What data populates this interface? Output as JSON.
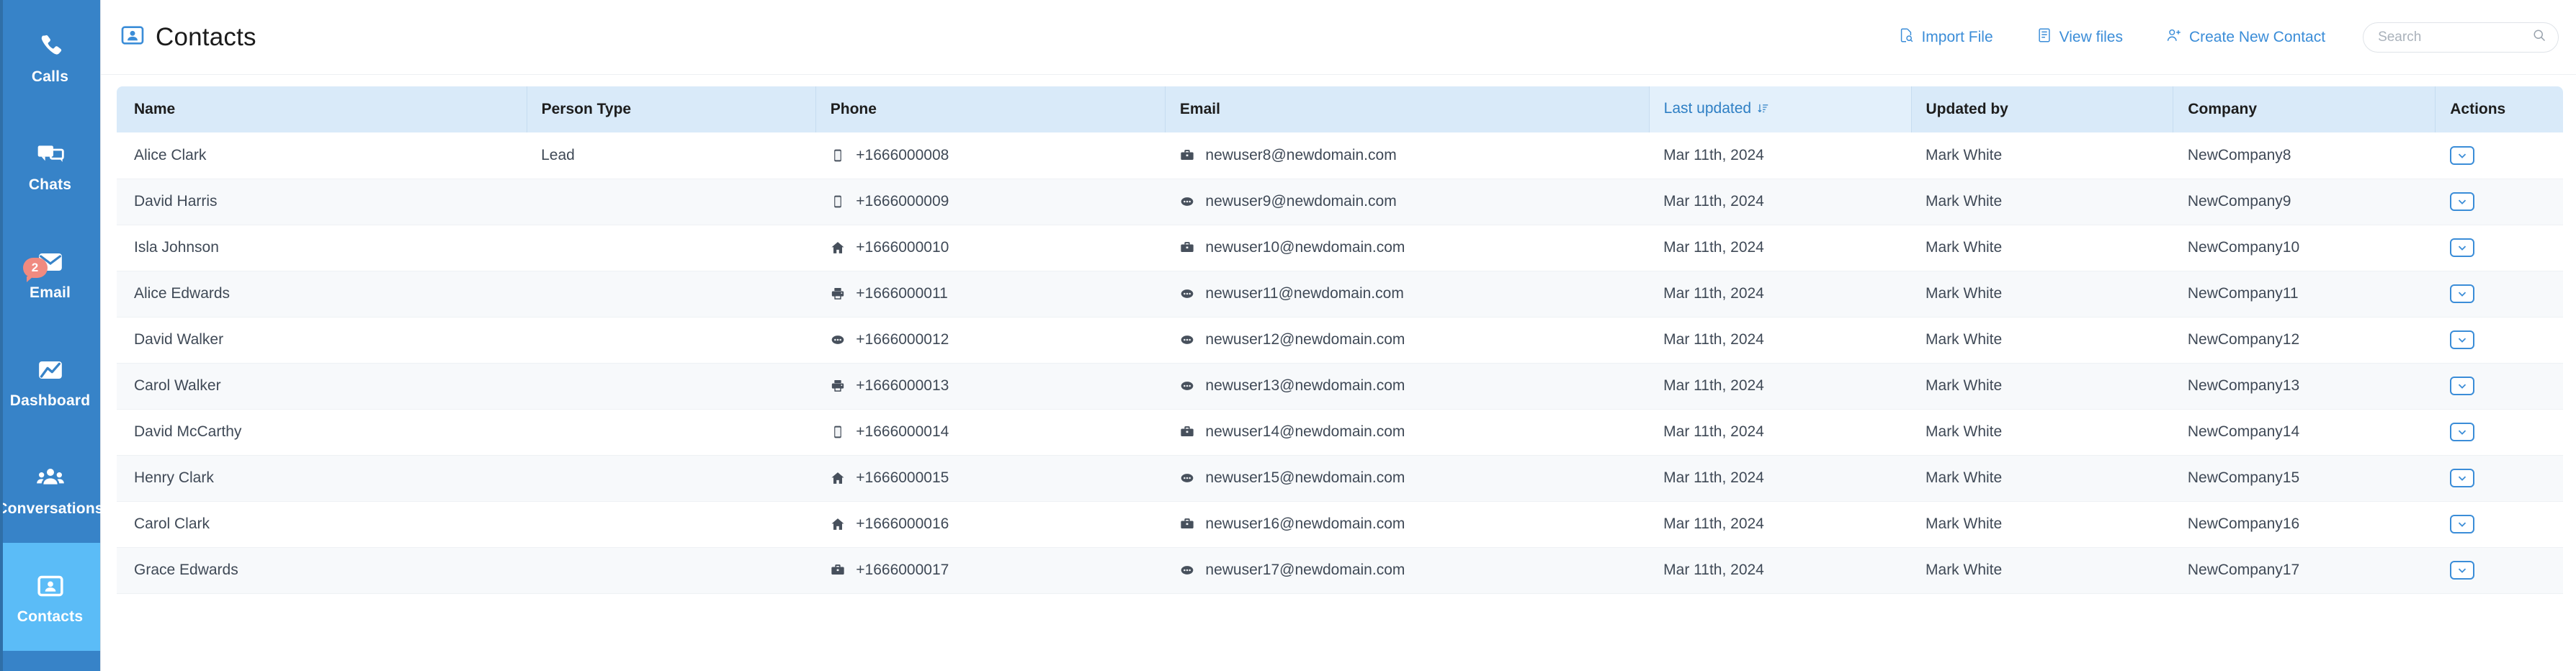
{
  "sidebar": {
    "items": [
      {
        "label": "Calls",
        "icon": "phone-icon",
        "active": false,
        "badge": null
      },
      {
        "label": "Chats",
        "icon": "chat-bubbles-icon",
        "active": false,
        "badge": null
      },
      {
        "label": "Email",
        "icon": "envelope-icon",
        "active": false,
        "badge": "2"
      },
      {
        "label": "Dashboard",
        "icon": "dashboard-icon",
        "active": false,
        "badge": null
      },
      {
        "label": "Conversations",
        "icon": "people-group-icon",
        "active": false,
        "badge": null
      },
      {
        "label": "Contacts",
        "icon": "contact-card-icon",
        "active": true,
        "badge": null
      }
    ]
  },
  "header": {
    "title": "Contacts",
    "title_icon": "contact-card-icon",
    "actions": [
      {
        "label": "Import File",
        "icon": "file-search-icon"
      },
      {
        "label": "View files",
        "icon": "list-document-icon"
      },
      {
        "label": "Create New Contact",
        "icon": "user-plus-icon"
      }
    ],
    "search": {
      "placeholder": "Search",
      "value": "",
      "icon": "search-icon"
    }
  },
  "table": {
    "columns": [
      {
        "label": "Name",
        "sorted": false
      },
      {
        "label": "Person Type",
        "sorted": false
      },
      {
        "label": "Phone",
        "sorted": false
      },
      {
        "label": "Email",
        "sorted": false
      },
      {
        "label": "Last updated",
        "sorted": true,
        "sort_icon": "sort-desc-icon"
      },
      {
        "label": "Updated by",
        "sorted": false
      },
      {
        "label": "Company",
        "sorted": false
      },
      {
        "label": "Actions",
        "sorted": false
      }
    ],
    "rows": [
      {
        "name": "Alice Clark",
        "person_type": "Lead",
        "phone_icon": "mobile-icon",
        "phone": "+1666000008",
        "email_icon": "briefcase-icon",
        "email": "newuser8@newdomain.com",
        "last_updated": "Mar 11th, 2024",
        "updated_by": "Mark White",
        "company": "NewCompany8",
        "action_icon": "chevron-down-icon"
      },
      {
        "name": "David Harris",
        "person_type": "",
        "phone_icon": "mobile-icon",
        "phone": "+1666000009",
        "email_icon": "ellipsis-icon",
        "email": "newuser9@newdomain.com",
        "last_updated": "Mar 11th, 2024",
        "updated_by": "Mark White",
        "company": "NewCompany9",
        "action_icon": "chevron-down-icon"
      },
      {
        "name": "Isla Johnson",
        "person_type": "",
        "phone_icon": "home-icon",
        "phone": "+1666000010",
        "email_icon": "briefcase-icon",
        "email": "newuser10@newdomain.com",
        "last_updated": "Mar 11th, 2024",
        "updated_by": "Mark White",
        "company": "NewCompany10",
        "action_icon": "chevron-down-icon"
      },
      {
        "name": "Alice Edwards",
        "person_type": "",
        "phone_icon": "printer-icon",
        "phone": "+1666000011",
        "email_icon": "ellipsis-icon",
        "email": "newuser11@newdomain.com",
        "last_updated": "Mar 11th, 2024",
        "updated_by": "Mark White",
        "company": "NewCompany11",
        "action_icon": "chevron-down-icon"
      },
      {
        "name": "David Walker",
        "person_type": "",
        "phone_icon": "ellipsis-icon",
        "phone": "+1666000012",
        "email_icon": "ellipsis-icon",
        "email": "newuser12@newdomain.com",
        "last_updated": "Mar 11th, 2024",
        "updated_by": "Mark White",
        "company": "NewCompany12",
        "action_icon": "chevron-down-icon"
      },
      {
        "name": "Carol Walker",
        "person_type": "",
        "phone_icon": "printer-icon",
        "phone": "+1666000013",
        "email_icon": "ellipsis-icon",
        "email": "newuser13@newdomain.com",
        "last_updated": "Mar 11th, 2024",
        "updated_by": "Mark White",
        "company": "NewCompany13",
        "action_icon": "chevron-down-icon"
      },
      {
        "name": "David McCarthy",
        "person_type": "",
        "phone_icon": "mobile-icon",
        "phone": "+1666000014",
        "email_icon": "briefcase-icon",
        "email": "newuser14@newdomain.com",
        "last_updated": "Mar 11th, 2024",
        "updated_by": "Mark White",
        "company": "NewCompany14",
        "action_icon": "chevron-down-icon"
      },
      {
        "name": "Henry Clark",
        "person_type": "",
        "phone_icon": "home-icon",
        "phone": "+1666000015",
        "email_icon": "ellipsis-icon",
        "email": "newuser15@newdomain.com",
        "last_updated": "Mar 11th, 2024",
        "updated_by": "Mark White",
        "company": "NewCompany15",
        "action_icon": "chevron-down-icon"
      },
      {
        "name": "Carol Clark",
        "person_type": "",
        "phone_icon": "home-icon",
        "phone": "+1666000016",
        "email_icon": "briefcase-icon",
        "email": "newuser16@newdomain.com",
        "last_updated": "Mar 11th, 2024",
        "updated_by": "Mark White",
        "company": "NewCompany16",
        "action_icon": "chevron-down-icon"
      },
      {
        "name": "Grace Edwards",
        "person_type": "",
        "phone_icon": "briefcase-icon",
        "phone": "+1666000017",
        "email_icon": "ellipsis-icon",
        "email": "newuser17@newdomain.com",
        "last_updated": "Mar 11th, 2024",
        "updated_by": "Mark White",
        "company": "NewCompany17",
        "action_icon": "chevron-down-icon"
      }
    ]
  },
  "colors": {
    "sidebar_blue": "#3783c8",
    "sidebar_active": "#5bbcf7",
    "accent_blue": "#3b8dd8",
    "table_header": "#d9eaf9",
    "sorted_header": "#e3f0fb",
    "badge_red": "#f08a80",
    "row_alt": "#f7f9fb"
  }
}
